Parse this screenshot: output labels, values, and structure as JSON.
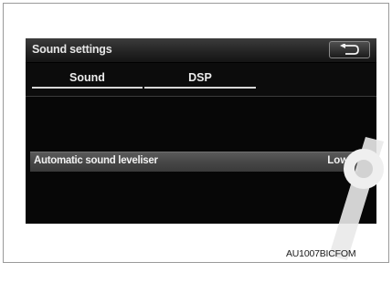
{
  "header": {
    "title": "Sound settings",
    "back_icon": "return-arrow-icon"
  },
  "tabs": [
    {
      "label": "Sound",
      "selected": true
    },
    {
      "label": "DSP",
      "selected": false
    }
  ],
  "settings": [
    {
      "label": "Automatic sound leveliser",
      "value": "Low>"
    }
  ],
  "figure_code": "AU1007BICFOM",
  "colors": {
    "screen_background": "#070707",
    "row_highlight": "#4a4a4a",
    "text": "#f0f0f0"
  }
}
